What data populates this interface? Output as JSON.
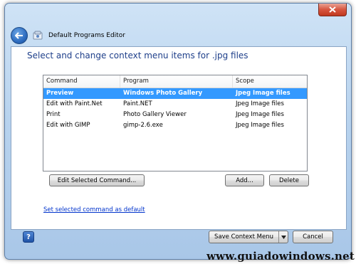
{
  "window": {
    "title": "Default Programs Editor"
  },
  "heading": "Select and change context menu items for .jpg files",
  "list": {
    "columns": [
      "Command",
      "Program",
      "Scope"
    ],
    "rows": [
      {
        "command": "Preview",
        "program": "Windows Photo Gallery",
        "scope": "Jpeg Image files",
        "selected": true
      },
      {
        "command": "Edit with Paint.Net",
        "program": "Paint.NET",
        "scope": "Jpeg Image files",
        "selected": false
      },
      {
        "command": "Print",
        "program": "Photo Gallery Viewer",
        "scope": "Jpeg Image files",
        "selected": false
      },
      {
        "command": "Edit with GIMP",
        "program": "gimp-2.6.exe",
        "scope": "Jpeg Image files",
        "selected": false
      }
    ]
  },
  "buttons": {
    "edit_selected": "Edit Selected Command...",
    "add": "Add...",
    "delete": "Delete",
    "save_context_menu": "Save Context Menu",
    "cancel": "Cancel",
    "help": "?"
  },
  "link_set_default": "Set selected command as default",
  "watermark": "www.guiadowindows.net",
  "icons": {
    "back": "back-arrow-icon",
    "app": "programs-editor-icon",
    "close": "close-x-icon",
    "help": "help-icon",
    "dropdown": "chevron-down-icon"
  },
  "colors": {
    "accent": "#1e3f8a",
    "selection": "#3399ff",
    "link": "#0033cc"
  }
}
